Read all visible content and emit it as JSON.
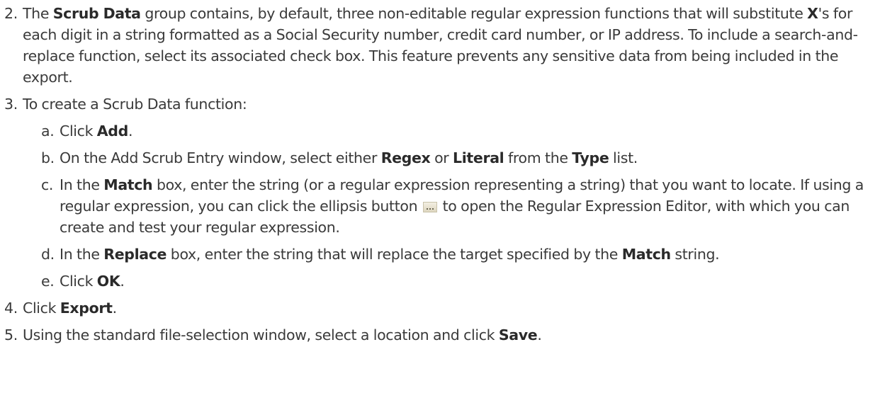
{
  "steps": [
    {
      "number": "2.",
      "parts": [
        "The ",
        "Scrub Data",
        " group contains, by default, three non-editable regular expression functions that will substitute ",
        "X",
        "'s for each digit in a string formatted as a Social Security number, credit card number, or IP address. To include a search-and-replace function, select its associated check box. This feature prevents any sensitive data from being included in the export."
      ]
    },
    {
      "number": "3.",
      "text": "To create a Scrub Data function:",
      "substeps": [
        {
          "letter": "a.",
          "parts": [
            "Click ",
            "Add",
            "."
          ]
        },
        {
          "letter": "b.",
          "parts": [
            "On the Add Scrub Entry window, select either ",
            "Regex",
            " or ",
            "Literal",
            " from the ",
            "Type",
            " list."
          ]
        },
        {
          "letter": "c.",
          "parts": [
            "In the ",
            "Match",
            " box, enter the string (or a regular expression representing a string) that you want to locate. If using a regular expression, you can click the ellipsis button",
            " to open the Regular Expression Editor, with which you can create and test your regular expression."
          ]
        },
        {
          "letter": "d.",
          "parts": [
            "In the ",
            "Replace",
            " box, enter the string that will replace the target specified by the ",
            "Match",
            " string."
          ]
        },
        {
          "letter": "e.",
          "parts": [
            "Click ",
            "OK",
            "."
          ]
        }
      ]
    },
    {
      "number": "4.",
      "parts": [
        "Click ",
        "Export",
        "."
      ]
    },
    {
      "number": "5.",
      "parts": [
        "Using the standard file-selection window, select a location and click ",
        "Save",
        "."
      ]
    }
  ],
  "icons": {
    "ellipsis_button": "ellipsis-button-icon"
  }
}
